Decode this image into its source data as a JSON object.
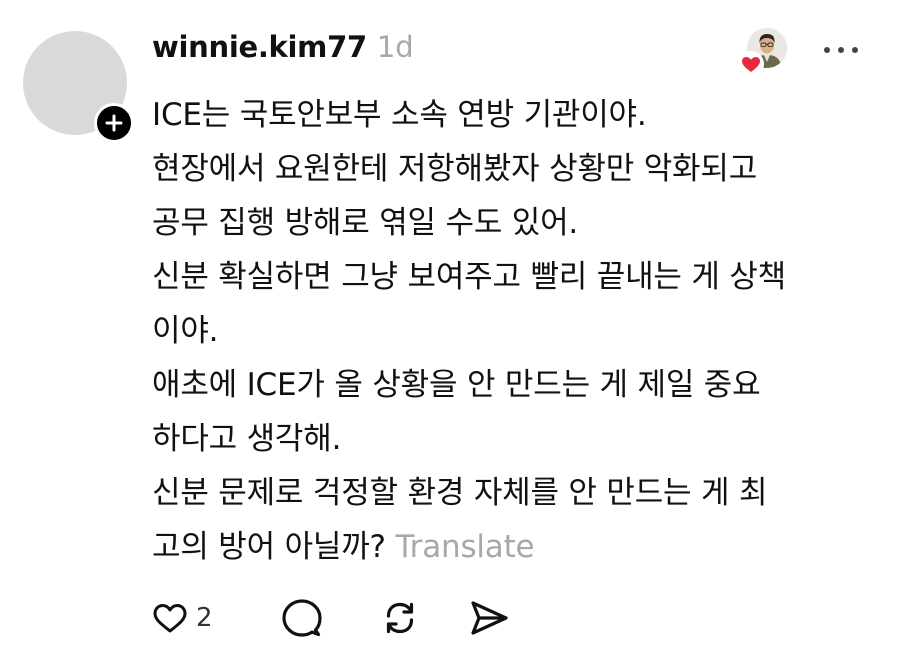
{
  "post": {
    "username": "winnie.kim77",
    "timestamp": "1d",
    "lines": [
      "ICE는 국토안보부 소속 연방 기관이야.",
      "현장에서 요원한테 저항해봤자 상황만 악화되고",
      "공무 집행 방해로 엮일 수도 있어.",
      "신분 확실하면 그냥 보여주고 빨리 끝내는 게 상책",
      "이야.",
      "애초에 ICE가 올 상황을 안 만드는 게 제일 중요",
      "하다고 생각해.",
      "신분 문제로 걱정할 환경 자체를 안 만드는 게 최",
      "고의 방어 아닐까?"
    ],
    "translate_label": "Translate"
  },
  "actions": {
    "like_count": "2"
  },
  "icons": {
    "follow": "plus-icon",
    "reaction": "heart-icon",
    "more": "more-horizontal-icon",
    "like": "heart-outline-icon",
    "comment": "comment-bubble-icon",
    "repost": "repost-icon",
    "share": "send-icon"
  },
  "colors": {
    "text": "#111111",
    "muted": "#a8a8a8",
    "avatar_placeholder": "#d9d9d9",
    "heart": "#e8283c"
  }
}
